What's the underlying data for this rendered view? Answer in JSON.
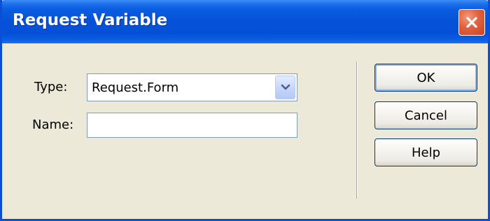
{
  "window": {
    "title": "Request Variable"
  },
  "form": {
    "type_label": "Type:",
    "type_value": "Request.Form",
    "name_label": "Name:",
    "name_value": ""
  },
  "buttons": {
    "ok": "OK",
    "cancel": "Cancel",
    "help": "Help"
  },
  "colors": {
    "titlebar": "#0552d8",
    "dialog_background": "#ece9d8",
    "close_button": "#e1613f"
  },
  "icons": {
    "close": "close-icon",
    "dropdown": "chevron-down-icon"
  }
}
